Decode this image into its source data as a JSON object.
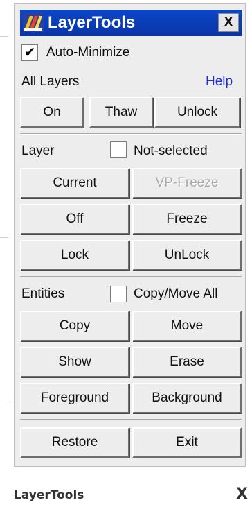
{
  "window": {
    "title": "LayerTools",
    "close_label": "X"
  },
  "auto_minimize": {
    "label": "Auto-Minimize",
    "checked": true,
    "mark": "✔"
  },
  "all_layers": {
    "label": "All Layers",
    "help": "Help",
    "buttons": [
      "On",
      "Thaw",
      "Unlock"
    ]
  },
  "layer": {
    "label": "Layer",
    "not_selected": {
      "label": "Not-selected",
      "checked": false
    },
    "buttons": {
      "current": "Current",
      "vp_freeze": "VP-Freeze",
      "off": "Off",
      "freeze": "Freeze",
      "lock": "Lock",
      "unlock": "UnLock"
    }
  },
  "entities": {
    "label": "Entities",
    "copy_move_all": {
      "label": "Copy/Move All",
      "checked": false
    },
    "buttons": {
      "copy": "Copy",
      "move": "Move",
      "show": "Show",
      "erase": "Erase",
      "foreground": "Foreground",
      "background": "Background"
    }
  },
  "footer_buttons": {
    "restore": "Restore",
    "exit": "Exit"
  },
  "caption": {
    "title": "LayerTools",
    "close": "X"
  },
  "colors": {
    "titlebar": "#0a3fb8",
    "help_link": "#1d2fd4",
    "disabled_text": "#a9a9a9"
  },
  "icons": {
    "app": "layertools-app-icon"
  }
}
